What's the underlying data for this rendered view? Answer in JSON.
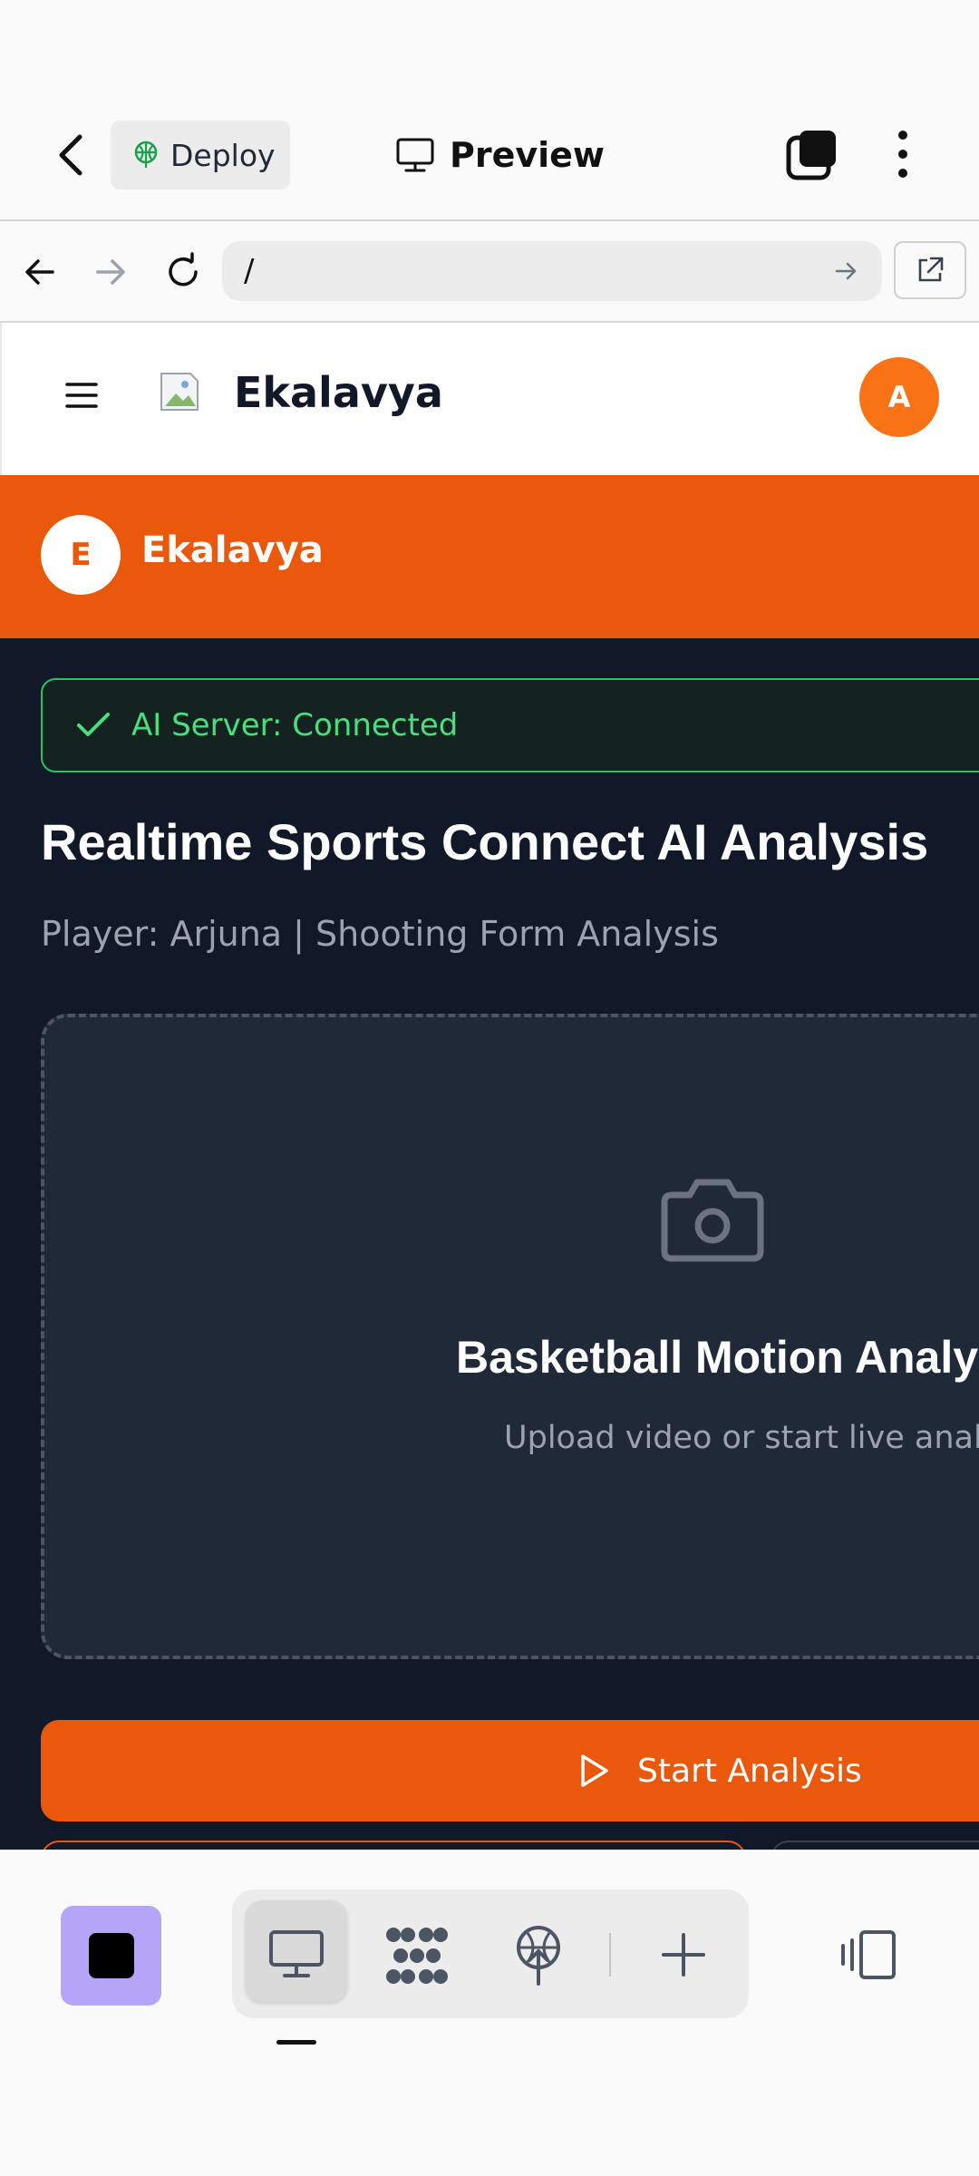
{
  "toolbar": {
    "deploy_label": "Deploy",
    "preview_label": "Preview"
  },
  "addressbar": {
    "url": "/"
  },
  "site": {
    "title": "Ekalavya",
    "avatar_letter": "A",
    "brand_letter": "E",
    "brand_name": "Ekalavya",
    "status_text": "AI Server: Connected",
    "main_title": "Realtime Sports Connect AI Analysis",
    "subtitle": "Player: Arjuna | Shooting Form Analysis",
    "upload_title": "Basketball Motion Analysis",
    "upload_sub": "Upload video or start live analysis",
    "start_button": "Start Analysis"
  },
  "colors": {
    "accent": "#ea580c",
    "avatar": "#f97316",
    "success": "#4ade80",
    "page_bg": "#111827",
    "purple": "#b4a5f8"
  },
  "bottombar": {
    "icons": [
      "stop-icon",
      "desktop-icon",
      "apps-icon",
      "deploy-icon",
      "add-icon",
      "devices-icon"
    ]
  }
}
